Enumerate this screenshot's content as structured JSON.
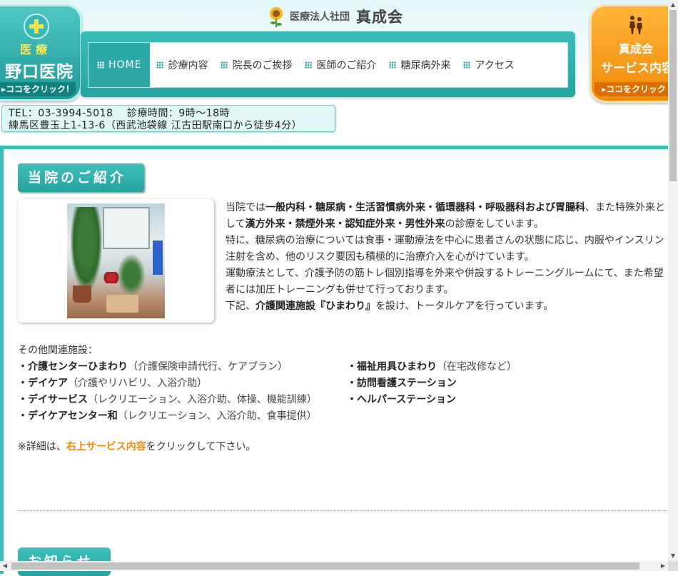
{
  "header": {
    "corp_label": "医療法人社団",
    "corp_name": "真成会",
    "left_badge": {
      "category": "医療",
      "clinic_name": "野口医院",
      "click_label": "▸ココをクリック！"
    },
    "right_badge": {
      "title": "真成会",
      "subtitle": "サービス内容",
      "click_label": "▸ココをクリック"
    }
  },
  "nav": {
    "items": [
      {
        "label": "HOME",
        "active": true
      },
      {
        "label": "診療内容",
        "active": false
      },
      {
        "label": "院長のご挨拶",
        "active": false
      },
      {
        "label": "医師のご紹介",
        "active": false
      },
      {
        "label": "糖尿病外来",
        "active": false
      },
      {
        "label": "アクセス",
        "active": false
      }
    ]
  },
  "contact": {
    "line1": "TEL：03-3994-5018　 診療時間：9時～18時",
    "line2": "練馬区豊玉上1-13-6（西武池袋線 江古田駅南口から徒歩4分）"
  },
  "intro_section": {
    "title": "当院のご紹介",
    "p1_pre": "当院では",
    "p1_bold": "一般内科・糖尿病・生活習慣病外来・循環器科・呼吸器科および胃腸科",
    "p1_mid": "、また特殊外来として",
    "p1_bold2": "漢方外来・禁煙外来・認知症外来・男性外来",
    "p1_post": "の診療をしています。",
    "p2": "特に、糖尿病の治療については食事・運動療法を中心に患者さんの状態に応じ、内服やインスリン注射を含め、他のリスク要因も積極的に治療介入を心がけています。",
    "p3": "運動療法として、介護予防の筋トレ個別指導を外来や併設するトレーニングルームにて、また希望者には加圧トレーニングも併せて行っております。",
    "p4_pre": "下記、",
    "p4_bold": "介護関連施設『ひまわり』",
    "p4_post": "を設け、トータルケアを行っています。"
  },
  "related": {
    "heading": "その他関連施設：",
    "left": [
      {
        "name": "・介護センターひまわり",
        "note": "（介護保険申請代行、ケアプラン）"
      },
      {
        "name": "・デイケア",
        "note": "（介護やリハビリ、入浴介助）"
      },
      {
        "name": "・デイサービス",
        "note": "（レクリエーション、入浴介助、体操、機能訓練）"
      },
      {
        "name": "・デイケアセンター和",
        "note": "（レクリエーション、入浴介助、食事提供）"
      }
    ],
    "right": [
      {
        "name": "・福祉用具ひまわり",
        "note": "（在宅改修など）"
      },
      {
        "name": "・訪問看護ステーション",
        "note": ""
      },
      {
        "name": "・ヘルパーステーション",
        "note": ""
      }
    ],
    "detail_pre": "※詳細は、",
    "detail_link": "右上サービス内容",
    "detail_post": "をクリックして下さい。"
  },
  "news_section": {
    "title": "お知らせ"
  },
  "colors": {
    "teal": "#2ca9a5",
    "orange": "#f08a0a",
    "yellow": "#f4e34d"
  }
}
